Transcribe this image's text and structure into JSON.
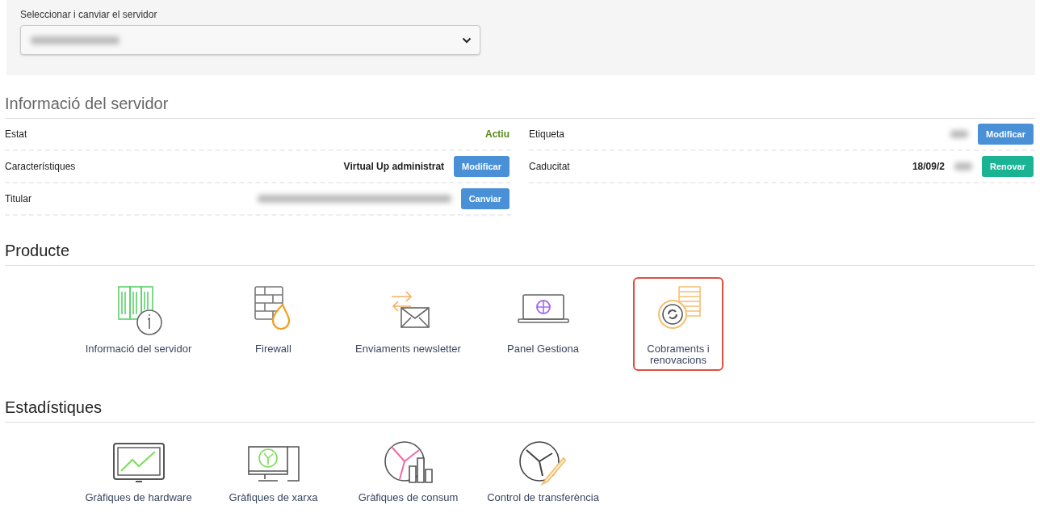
{
  "server_select": {
    "label": "Seleccionar i canviar el servidor"
  },
  "server_info": {
    "title": "Informació del servidor",
    "left_rows": [
      {
        "label": "Estat",
        "value": "Actiu",
        "color": "#5a8a1a"
      },
      {
        "label": "Característiques",
        "value": "Virtual Up administrat",
        "button": {
          "label": "Modificar",
          "color": "#4a90d6"
        }
      },
      {
        "label": "Titular",
        "value_redacted": true,
        "button": {
          "label": "Canviar",
          "color": "#4a90d6"
        }
      }
    ],
    "right_rows": [
      {
        "label": "Etiqueta",
        "value_redacted": true,
        "button": {
          "label": "Modificar",
          "color": "#4a90d6"
        }
      },
      {
        "label": "Caducitat",
        "value": "18/09/2",
        "value_redacted": true,
        "button": {
          "label": "Renovar",
          "color": "#1ab394"
        }
      }
    ]
  },
  "product": {
    "title": "Producte",
    "items": [
      {
        "label": "Informació del servidor",
        "highlighted": false
      },
      {
        "label": "Firewall",
        "highlighted": false
      },
      {
        "label": "Enviaments newsletter",
        "highlighted": false
      },
      {
        "label": "Panel Gestiona",
        "highlighted": false
      },
      {
        "label": "Cobraments i renovacions",
        "highlighted": true
      }
    ]
  },
  "statistics": {
    "title": "Estadístiques",
    "items": [
      {
        "label": "Gràfiques de hardware"
      },
      {
        "label": "Gràfiques de xarxa"
      },
      {
        "label": "Gràfiques de consum"
      },
      {
        "label": "Control de transferència"
      }
    ]
  }
}
